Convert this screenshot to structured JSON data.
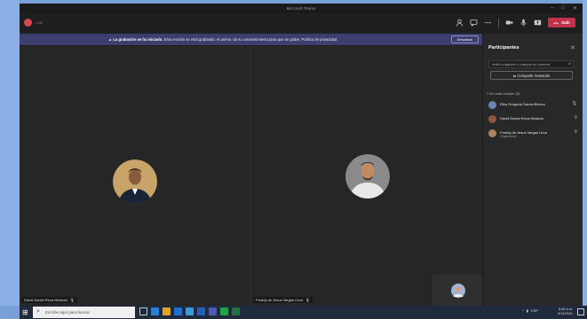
{
  "window": {
    "title": "Microsoft Teams",
    "controls": [
      "–",
      "□",
      "✕"
    ]
  },
  "toolbar": {
    "meeting_time": "1:05",
    "leave_label": "Salir",
    "icons": [
      "participants-icon",
      "chat-icon",
      "more-icon",
      "camera-icon",
      "mic-icon",
      "share-screen-icon"
    ]
  },
  "banner": {
    "title": "La grabación se ha iniciado.",
    "text": "Esta reunión se está grabando. Al unirse, da su consentimiento para que se grabe. Política de privacidad",
    "dismiss_label": "Descartar"
  },
  "tiles": [
    {
      "name": "David Daniel Reza Miranda",
      "skin": "#8a5a3c",
      "shirt": "#1a2438",
      "bg": "#c9a46a"
    },
    {
      "name": "Freddy de Jesus Vargas Lima",
      "skin": "#c28a63",
      "shirt": "#e8e8e8",
      "bg": "#8a8a8a"
    }
  ],
  "panel": {
    "title": "Participantes",
    "invite_placeholder": "Invite a alguien o marque un número",
    "share_label": "Compartir invitación",
    "section_label": "En esta reunión (3)",
    "participants": [
      {
        "name": "Elba Gregoria Garcia Blanco",
        "role": "",
        "color": "#6a86b8"
      },
      {
        "name": "David Daniel Reza Miranda",
        "role": "",
        "color": "#8a5a3c"
      },
      {
        "name": "Freddy de Jesus Vargas Lima",
        "role": "Organizador",
        "color": "#a88560"
      }
    ]
  },
  "taskbar": {
    "search_placeholder": "Escribe aquí para buscar",
    "time": "8:52 a.m.",
    "date": "5/14/2021",
    "tray_lang": "ESP"
  }
}
